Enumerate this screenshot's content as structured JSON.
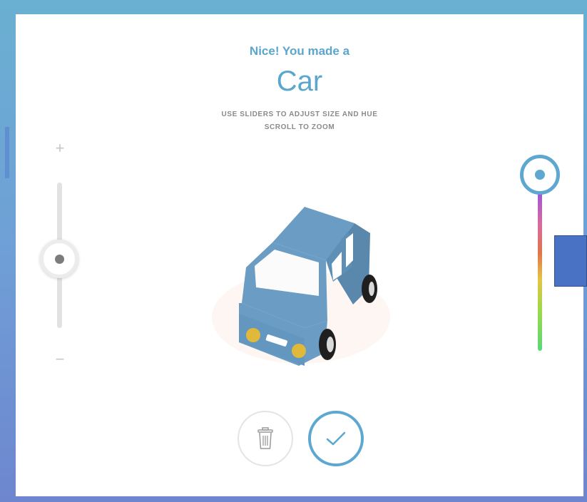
{
  "header": {
    "subtitle": "Nice! You made a",
    "object_name": "Car"
  },
  "instructions": {
    "line1": "USE SLIDERS TO ADJUST SIZE AND HUE",
    "line2": "SCROLL TO ZOOM"
  },
  "size_slider": {
    "plus_label": "+",
    "minus_label": "−",
    "value_fraction": 0.5
  },
  "hue_slider": {
    "value_fraction": 0.0,
    "accent_color": "#5da7d0"
  },
  "actions": {
    "delete_icon": "trash-icon",
    "confirm_icon": "checkmark-icon"
  },
  "colors": {
    "accent": "#5aa6cd",
    "car_body": "#6a9cc4"
  }
}
